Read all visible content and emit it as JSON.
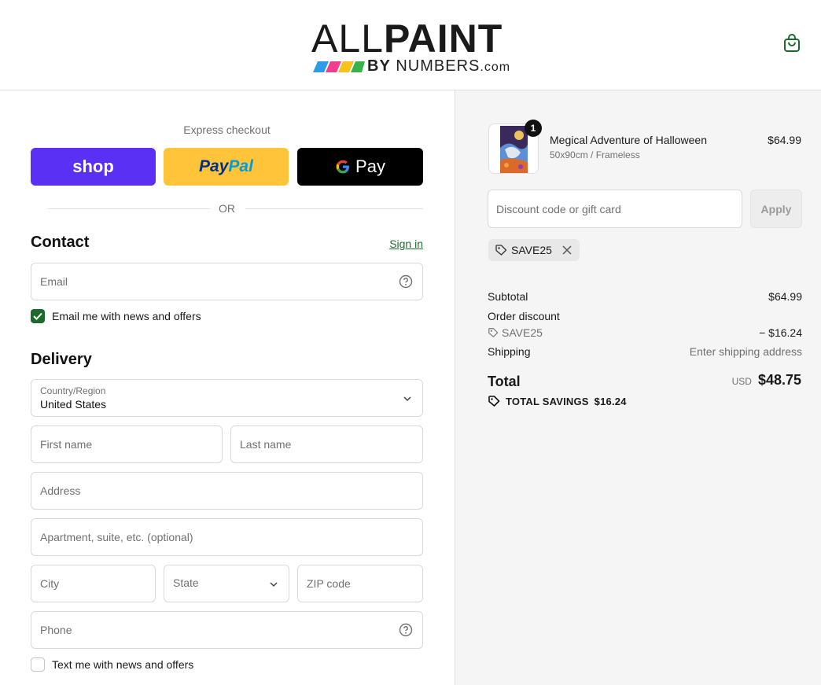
{
  "header": {
    "logo_main_light": "ALL",
    "logo_main_bold": "PAINT",
    "logo_sub_by": "BY",
    "logo_sub_numbers": "NUMBERS",
    "logo_sub_com": ".com",
    "logo_stripe_colors": [
      "#2e9be6",
      "#ee3f8f",
      "#f6c21c",
      "#38b24a"
    ],
    "cart_icon": "shopping-bag-icon"
  },
  "express": {
    "label": "Express checkout",
    "shop_label": "shop",
    "paypal_pay": "Pay",
    "paypal_pal": "Pal",
    "gpay_g": "G",
    "gpay_label": "Pay",
    "or_label": "OR"
  },
  "contact": {
    "title": "Contact",
    "signin": "Sign in",
    "email_placeholder": "Email",
    "email_news_label": "Email me with news and offers",
    "email_news_checked": true
  },
  "delivery": {
    "title": "Delivery",
    "country_label": "Country/Region",
    "country_value": "United States",
    "first_name_placeholder": "First name",
    "last_name_placeholder": "Last name",
    "address_placeholder": "Address",
    "apartment_placeholder": "Apartment, suite, etc. (optional)",
    "city_placeholder": "City",
    "state_placeholder": "State",
    "zip_placeholder": "ZIP code",
    "phone_placeholder": "Phone",
    "text_news_label": "Text me with news and offers",
    "text_news_checked": false
  },
  "order": {
    "product_name": "Megical Adventure of Halloween",
    "product_variant": "50x90cm / Frameless",
    "product_price": "$64.99",
    "quantity": "1",
    "discount_placeholder": "Discount code or gift card",
    "apply_label": "Apply",
    "applied_code": "SAVE25",
    "subtotal_label": "Subtotal",
    "subtotal_value": "$64.99",
    "order_discount_label": "Order discount",
    "discount_code": "SAVE25",
    "discount_value": "− $16.24",
    "shipping_label": "Shipping",
    "shipping_value": "Enter shipping address",
    "total_label": "Total",
    "total_currency": "USD",
    "total_value": "$48.75",
    "savings_label": "TOTAL SAVINGS",
    "savings_value": "$16.24"
  },
  "colors": {
    "accent_green": "#1d6b2c",
    "shop_purple": "#5a31f4",
    "paypal_yellow": "#ffc439"
  }
}
